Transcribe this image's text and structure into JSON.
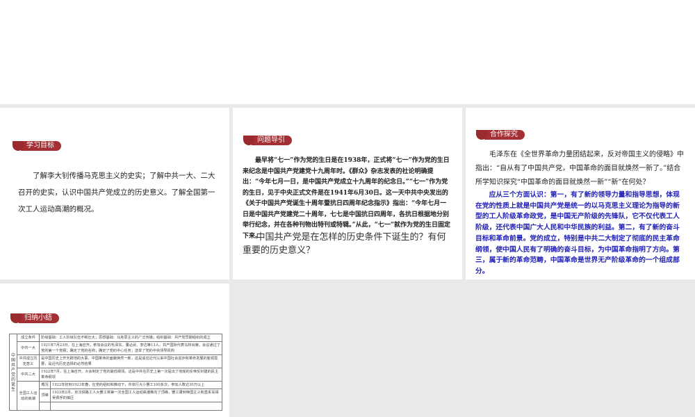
{
  "panel1": {
    "tag": "学习目标",
    "text": "了解李大钊传播马克思主义的史实；了解中共一大、二大召开的史实，认识中国共产党成立的历史意义。了解全国第一次工人运动高潮的概况。"
  },
  "panel2": {
    "tag": "问题导引",
    "text": "最早将“七一”作为党的生日是在1938年，正式将“七一”作为党的生日来纪念是中国共产党建党十九周年时。《群众》杂志发表的社论明确提出：“今年七月一日，是中国共产党成立十九周年的纪念日。”“七一”作为党的生日，见于中央正式文件是在1941年6月30日。这一天中共中央发出的《关于中国共产党诞生十周年暨抗日四周年纪念指示》指出：“今年七月一日是中国共产党建党二十周年，七七是中国抗日四周年，各抗日根据地分别举行纪念，并在各种刊物出特刊或特辑。”从此，“七一”就作为党的生日固定下来。",
    "question": "中国共产党是在怎样的历史条件下诞生的？有何重要的历史意义？"
  },
  "panel3": {
    "tag": "合作探究",
    "text": "毛泽东在《全世界革命力量团结起来，反对帝国主义的侵略》中指出：“自从有了中国共产党，中国革命的面目就焕然一新了。”结合所学知识探究“中国革命的面目就焕然一新”“新”在何处？",
    "answer": "应从三个方面认识：第一，有了新的领导力量和指导思想，体现在党的性质上就是中国共产党是统一的以马克思主义理论为指导的新型的工人阶级革命政党，是中国无产阶级的先锋队，它不仅代表工人阶级，还代表中国广大人民和中华民族的利益。第二，有了新的奋斗目标和革命前景。党的成立，特别是中共二大制定了彻底的民主革命纲领，使中国人民有了明确的奋斗目标，为中国革命指明了方向。第三，属于新的革命范畴，中国革命是世界无产阶级革命的一个组成部分。"
  },
  "panel4": {
    "tag": "归纳小结",
    "table": {
      "side": "中国共产党的诞生",
      "rows": [
        {
          "h": "成立条件",
          "c": "阶级基础：工人阶级队伍不断壮大；思想基础：马克思主义的广泛传播；组织基础：共产党早期组织的成立"
        },
        {
          "h": "中共一大",
          "c": "1921年7月23日，在上海召开。参加会议的毛泽东、董必武、李达等13人，共产国际代表马林出席。会议通过了党的第一个党纲；确定了党的名称；确定了党的中心任务；选举了党的中央领导机构"
        },
        {
          "h": "中共成立历史意义",
          "c": "是中国历史上开天辟地的大事，中国革命的面貌焕然一新，这是适应近代以来中国社会进步和革命发展的客观需要，是近代历史选择的必然结果"
        },
        {
          "h": "中共二大",
          "c": "1922年7月，在上海召开。大会制定了党的最低纲领。这是中共在历史上第一次提出了彻底的反帝反封建的民主革命纲领"
        }
      ],
      "labor": {
        "h": "全国工人运动的高潮",
        "rows": [
          {
            "k": "概况",
            "c": "1922年初到1923年春，在党的组织和推动下，共举行大小罢工100多次，参加人数达30万以上"
          },
          {
            "k": "顶峰",
            "c": "1923年2月，京汉铁路工人大罢工将第一次全国工人运动高潮推向了顶峰，罢工遭到帝国主义和直系军阀吴佩孚的镇压"
          }
        ]
      }
    }
  }
}
